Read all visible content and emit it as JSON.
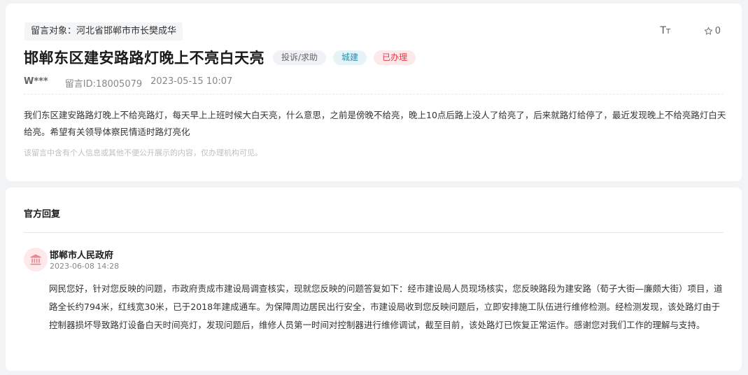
{
  "message": {
    "target_label": "留言对象：",
    "target_value": "河北省邯郸市市长樊成华",
    "title": "邯郸东区建安路路灯晚上不亮白天亮",
    "tags": {
      "type": "投诉/求助",
      "category": "城建",
      "status": "已办理"
    },
    "tools": {
      "font_icon": "font-size-icon",
      "favorite_icon": "star-icon",
      "favorite_count": "0"
    },
    "author": "W***",
    "message_id": "留言ID:18005079",
    "datetime": "2023-05-15 10:07",
    "content": "我们东区建安路路灯晚上不给亮路灯，每天早上上班时候大白天亮，什么意思，之前是傍晚不给亮，晚上10点后路上没人了给亮了，后来就路灯给停了，最近发现晚上不给亮路灯白天给亮。希望有关领导体察民情适时路灯亮化",
    "privacy_notice": "该留言中含有个人信息或其他不便公开展示的内容，仅办理机构可见。"
  },
  "reply": {
    "heading": "官方回复",
    "org_icon": "government-building-icon",
    "org_name": "邯郸市人民政府",
    "datetime": "2023-06-08 14:28",
    "content": "网民您好，针对您反映的问题，市政府责成市建设局调查核实，现就您反映的问题答复如下：经市建设局人员现场核实，您反映路段为建安路（荀子大街—廉颇大街）项目，道路全长约794米，红线宽30米，已于2018年建成通车。为保障周边居民出行安全，市建设局收到您反映问题后，立即安排施工队伍进行维修检测。经检测发现，该处路灯由于控制器损坏导致路灯设备白天时间亮灯，发现问题后，维修人员第一时间对控制器进行维修调试，截至目前，该处路灯已恢复正常运作。感谢您对我们工作的理解与支持。"
  },
  "colors": {
    "status_red": "#e23b48",
    "category_teal": "#2f8ca8",
    "avatar_bg": "#fde8ea"
  }
}
